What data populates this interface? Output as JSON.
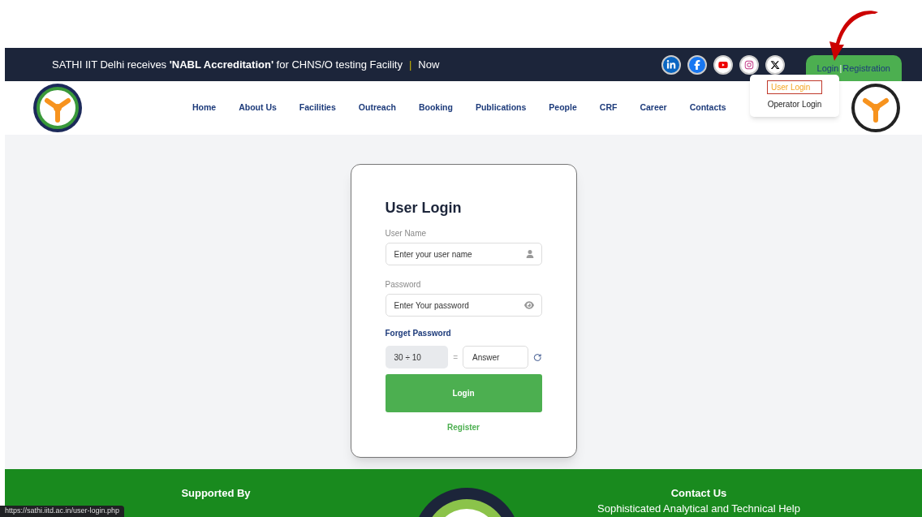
{
  "announcement": {
    "text": "SATHI IIT Delhi receives **'NABL Accreditation'** for CHNS/O testing Facility",
    "separator": "|",
    "tag": "Now"
  },
  "social_links": [
    {
      "kind": "linkedin"
    },
    {
      "kind": "facebook"
    },
    {
      "kind": "youtube"
    },
    {
      "kind": "instagram"
    },
    {
      "kind": "x"
    }
  ],
  "auth_tab": {
    "login": "Login",
    "separator": "|",
    "registration": "Registration"
  },
  "auth_menu": [
    {
      "label": "User Login",
      "selected": true
    },
    {
      "label": "Operator Login",
      "selected": false
    }
  ],
  "nav": [
    "Home",
    "About Us",
    "Facilities",
    "Outreach",
    "Booking",
    "Publications",
    "People",
    "CRF",
    "Career",
    "Contacts"
  ],
  "login_card": {
    "title": "User Login",
    "username_label": "User Name",
    "username_placeholder": "Enter your user name",
    "password_label": "Password",
    "password_placeholder": "Enter Your password",
    "forgot_link": "Forget Password",
    "captcha_question": "30 ÷ 10",
    "captcha_equals": "=",
    "captcha_placeholder": "Answer",
    "submit": "Login",
    "register_link": "Register"
  },
  "footer": {
    "supported_by": "Supported By",
    "contact_heading": "Contact Us",
    "contact_text": "Sophisticated Analytical and Technical Help"
  },
  "status_url": "https://sathi.iitd.ac.in/user-login.php"
}
